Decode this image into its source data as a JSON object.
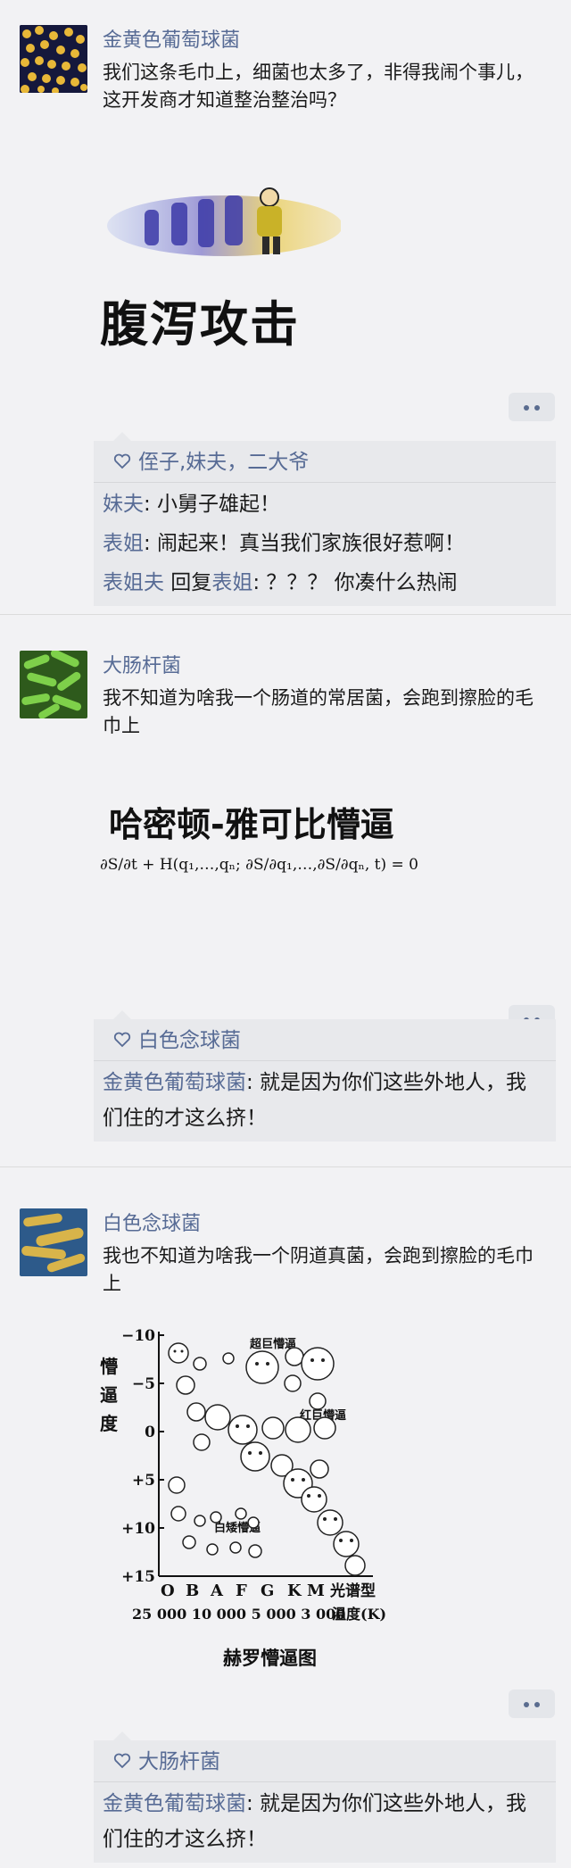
{
  "posts": [
    {
      "name": "金黄色葡萄球菌",
      "text": "我们这条毛巾上，细菌也太多了，非得我闹个事儿，这开发商才知道整治整治吗？",
      "image_caption": "腹泻攻击",
      "likes": "侄子,妹夫，二大爷",
      "comments": [
        {
          "user": "妹夫",
          "text": ": 小舅子雄起！"
        },
        {
          "user": "表姐",
          "text": ": 闹起来！真当我们家族很好惹啊！"
        },
        {
          "user": "表姐夫",
          "reply_word": " 回复",
          "reply_to": "表姐",
          "text": ": ？？？ 你凑什么热闹"
        }
      ]
    },
    {
      "name": "大肠杆菌",
      "text": "我不知道为啥我一个肠道的常居菌，会跑到擦脸的毛巾上",
      "image_caption": "哈密顿-雅可比懵逼",
      "formula": "∂S/∂t + H(q₁,…,qₙ; ∂S/∂q₁,…,∂S/∂qₙ, t) = 0",
      "likes": "白色念球菌",
      "comments": [
        {
          "user": "金黄色葡萄球菌",
          "text": ": 就是因为你们这些外地人，我们住的才这么挤！"
        }
      ]
    },
    {
      "name": "白色念球菌",
      "text": "我也不知道为啥我一个阴道真菌，会跑到擦脸的毛巾上",
      "diagram": {
        "ylabel": "懵逼度",
        "yticks": [
          "−10",
          "−5",
          "0",
          "+5",
          "+10",
          "+15"
        ],
        "xticks": [
          "O",
          "B",
          "A",
          "F",
          "G",
          "K",
          "M"
        ],
        "xlabel": "光谱型",
        "temps": "25 000 10 000 5 000 3 000",
        "templabel": "温度(K)",
        "groups": [
          "超巨懵逼",
          "红巨懵逼",
          "白矮懵逼"
        ],
        "title": "赫罗懵逼图"
      },
      "likes": "大肠杆菌",
      "comments": [
        {
          "user": "金黄色葡萄球菌",
          "text": ": 就是因为你们这些外地人，我们住的才这么挤！"
        }
      ]
    }
  ],
  "colors": {
    "link": "#576b95",
    "text": "#1a1a1a",
    "background": "#f2f2f4"
  }
}
